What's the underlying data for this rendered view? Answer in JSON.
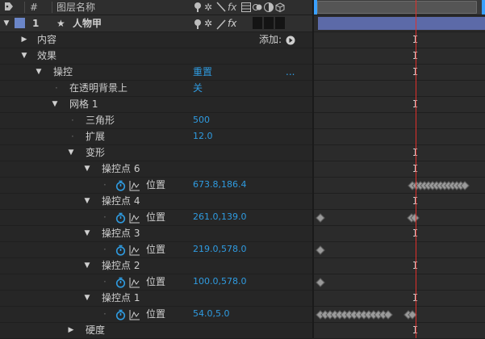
{
  "header": {
    "num": "#",
    "layer_name_col": "图层名称",
    "switch_fx": "fx"
  },
  "layer": {
    "number": "1",
    "name": "人物甲",
    "color": "#6b86c8"
  },
  "rows": {
    "contents": "内容",
    "add_label": "添加:",
    "effects": "效果",
    "puppet": "操控",
    "reset": "重置",
    "ellipsis": "...",
    "on_transparent": "在透明背景上",
    "on_transparent_value": "关",
    "mesh": "网格 1",
    "triangles": "三角形",
    "triangles_value": "500",
    "expansion": "扩展",
    "expansion_value": "12.0",
    "deform": "变形",
    "hardness": "硬度"
  },
  "pins": [
    {
      "label": "操控点 6",
      "prop": "位置",
      "value": "673.8,186.4"
    },
    {
      "label": "操控点 4",
      "prop": "位置",
      "value": "261.0,139.0"
    },
    {
      "label": "操控点 3",
      "prop": "位置",
      "value": "219.0,578.0"
    },
    {
      "label": "操控点 2",
      "prop": "位置",
      "value": "100.0,578.0"
    },
    {
      "label": "操控点 1",
      "prop": "位置",
      "value": "54.0,5.0"
    }
  ],
  "timeline": {
    "playhead_color": "#e0302b",
    "layer_bar_color": "#5c6aa8",
    "ibeam": "I"
  },
  "colors": {
    "value_blue": "#2f9be0",
    "panel_bg": "#262626"
  }
}
